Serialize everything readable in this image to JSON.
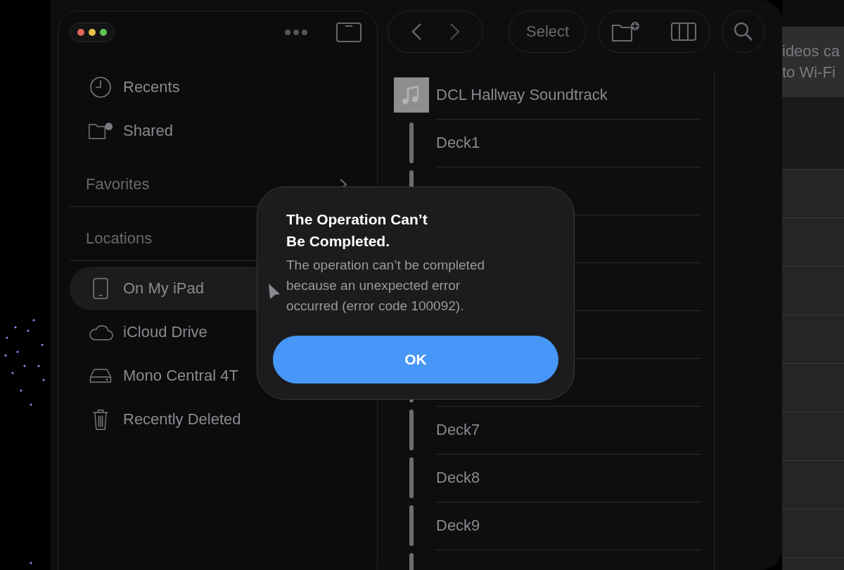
{
  "sidebar": {
    "items": [
      {
        "label": "Recents",
        "kind": "clock",
        "selected": false
      },
      {
        "label": "Shared",
        "kind": "shared-folder",
        "selected": false
      }
    ],
    "sections": [
      {
        "title": "Favorites",
        "expanded": false
      },
      {
        "title": "Locations",
        "expanded": true,
        "items": [
          {
            "label": "On My iPad",
            "kind": "ipad",
            "selected": true
          },
          {
            "label": "iCloud Drive",
            "kind": "cloud",
            "selected": false
          },
          {
            "label": "Mono Central 4T",
            "kind": "drive",
            "selected": false
          },
          {
            "label": "Recently Deleted",
            "kind": "trash",
            "selected": false
          }
        ]
      }
    ]
  },
  "toolbar": {
    "select_label": "Select"
  },
  "files": [
    {
      "name": "DCL Hallway Soundtrack",
      "kind": "audio"
    },
    {
      "name": "Deck1",
      "kind": "deck"
    },
    {
      "kind": "partial"
    },
    {
      "kind": "covered"
    },
    {
      "kind": "covered"
    },
    {
      "kind": "covered"
    },
    {
      "kind": "partial"
    },
    {
      "name": "Deck7",
      "kind": "deck"
    },
    {
      "name": "Deck8",
      "kind": "deck"
    },
    {
      "name": "Deck9",
      "kind": "deck"
    },
    {
      "kind": "partial"
    }
  ],
  "background_text": [
    "ideos ca",
    "to Wi-Fi"
  ],
  "alert": {
    "title": "The Operation Can’t Be Completed.",
    "message": "The operation can’t be completed because an unexpected error occurred (error code 100092).",
    "button": "OK"
  }
}
